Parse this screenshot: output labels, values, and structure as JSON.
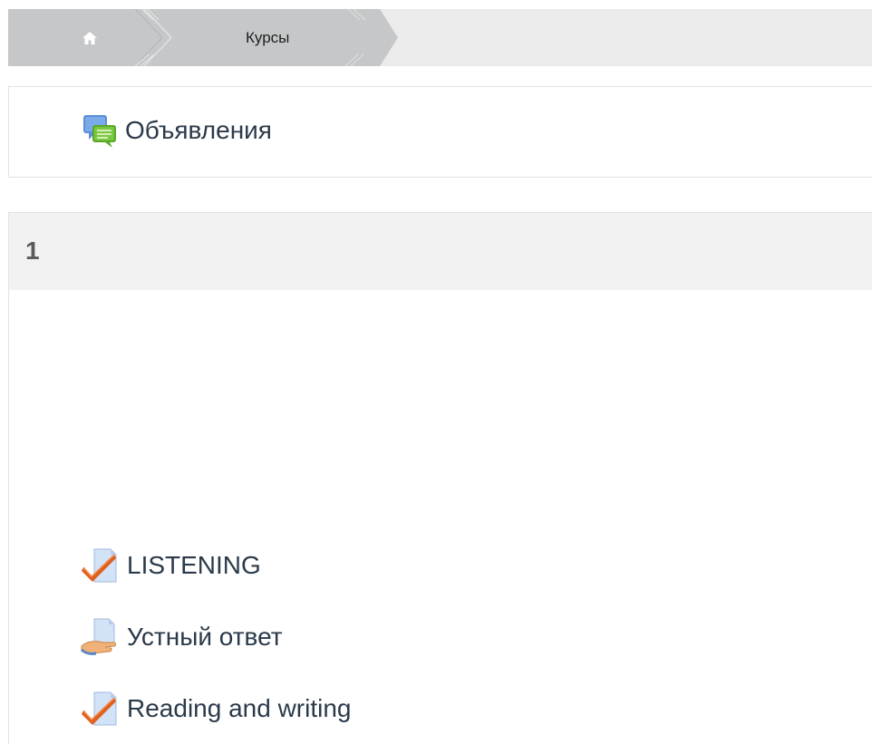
{
  "breadcrumb": {
    "home_icon": "home-icon",
    "courses_label": "Курсы"
  },
  "announcements": {
    "icon": "forum-chat-icon",
    "label": "Объявления"
  },
  "section": {
    "number": "1",
    "activities": [
      {
        "icon": "quiz-checkmark-icon",
        "label": "LISTENING"
      },
      {
        "icon": "assignment-hand-icon",
        "label": "Устный ответ"
      },
      {
        "icon": "quiz-checkmark-icon",
        "label": "Reading and writing"
      }
    ]
  },
  "colors": {
    "breadcrumb_bg": "#ebebeb",
    "breadcrumb_segment": "#c6c7c8",
    "section_header_bg": "#f2f2f2",
    "link_text": "#2b3a4a",
    "check_orange": "#e0601e"
  }
}
